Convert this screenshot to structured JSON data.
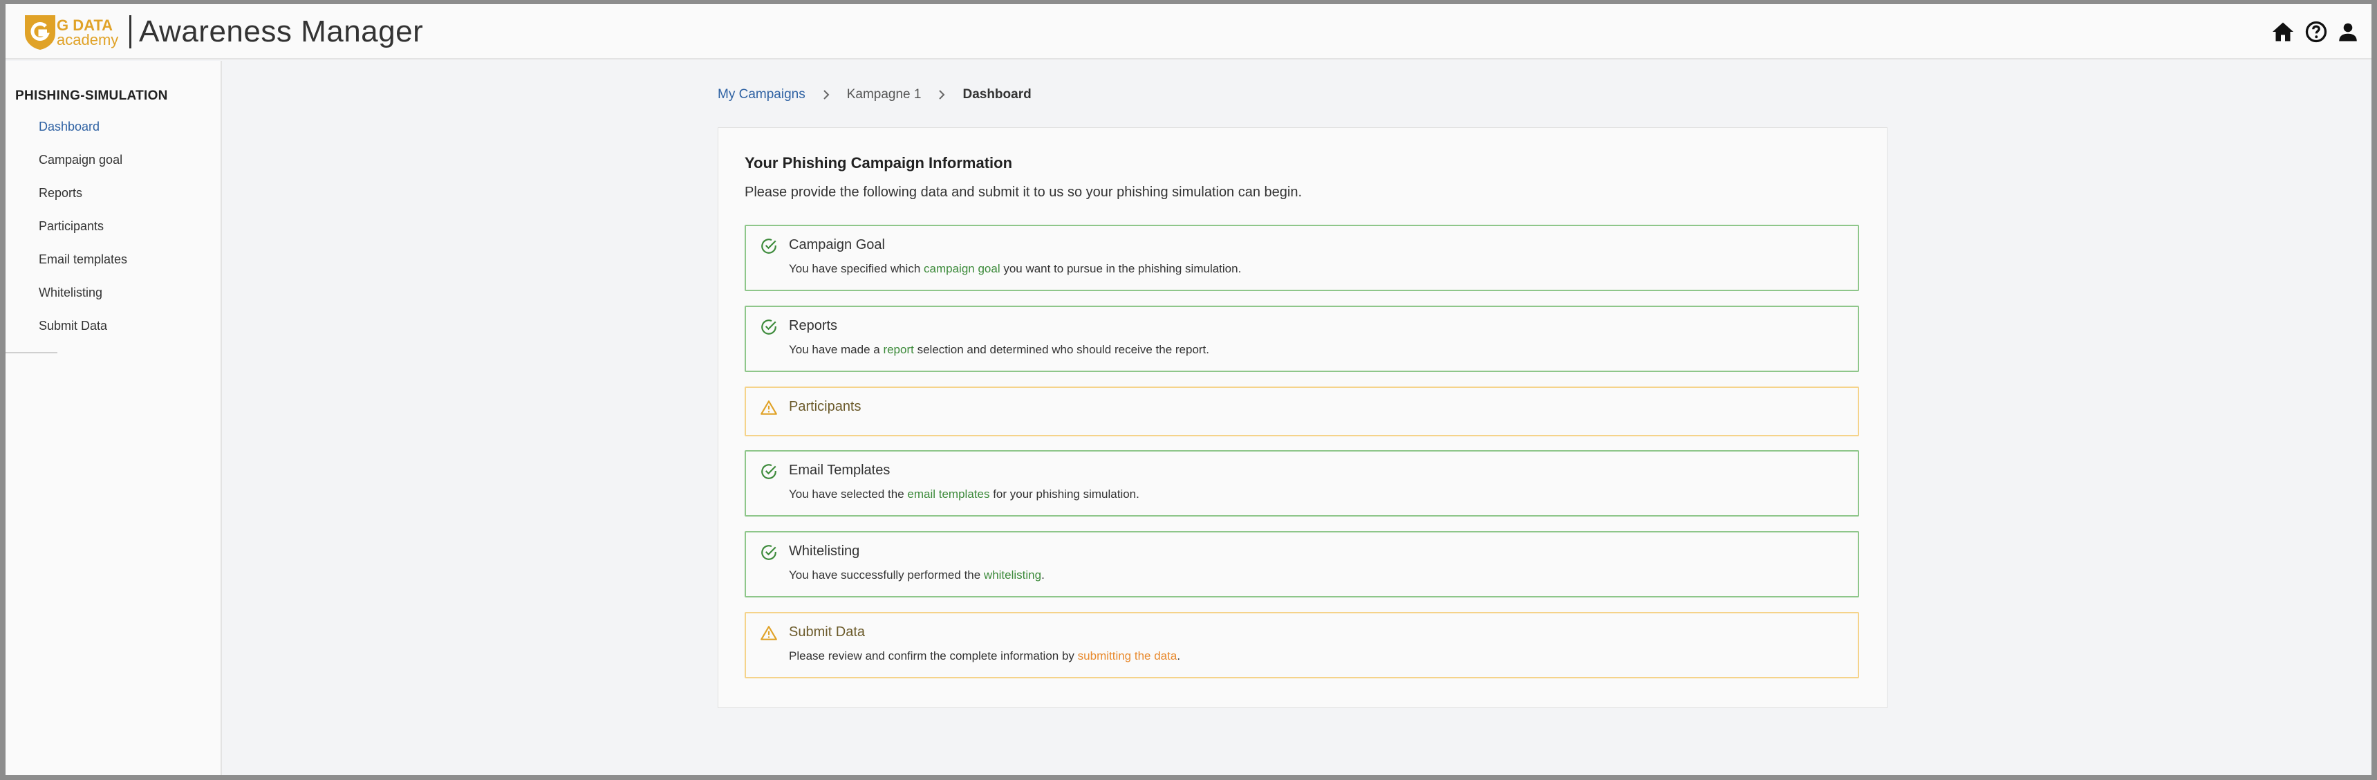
{
  "app": {
    "logo_line1": "G DATA",
    "logo_line2": "academy",
    "title": "Awareness Manager"
  },
  "topbar_icons": [
    "home-icon",
    "help-icon",
    "account-icon"
  ],
  "sidebar": {
    "section_title": "PHISHING-SIMULATION",
    "items": [
      {
        "label": "Dashboard",
        "active": true
      },
      {
        "label": "Campaign goal"
      },
      {
        "label": "Reports"
      },
      {
        "label": "Participants"
      },
      {
        "label": "Email templates"
      },
      {
        "label": "Whitelisting"
      },
      {
        "label": "Submit Data"
      }
    ]
  },
  "breadcrumb": {
    "home": "My Campaigns",
    "campaign": "Kampagne 1",
    "current": "Dashboard"
  },
  "card": {
    "title": "Your Phishing Campaign Information",
    "subtitle": "Please provide the following data and submit it to us so your phishing simulation can begin."
  },
  "items": [
    {
      "status": "done",
      "icon": "check-circle-icon",
      "title": "Campaign Goal",
      "pre": "You have specified which ",
      "link": "campaign goal",
      "post": " you want to pursue in the phishing simulation."
    },
    {
      "status": "done",
      "icon": "check-circle-icon",
      "title": "Reports",
      "pre": "You have made a ",
      "link": "report",
      "post": " selection and determined who should receive the report."
    },
    {
      "status": "warning",
      "icon": "warning-icon",
      "title": "Participants"
    },
    {
      "status": "done",
      "icon": "check-circle-icon",
      "title": "Email Templates",
      "pre": "You have selected the ",
      "link": "email templates",
      "post": " for your phishing simulation."
    },
    {
      "status": "done",
      "icon": "check-circle-icon",
      "title": "Whitelisting",
      "pre": "You have successfully performed the ",
      "link": "whitelisting",
      "post": "."
    },
    {
      "status": "warning",
      "icon": "warning-icon",
      "title": "Submit Data",
      "pre": "Please review and confirm the complete information by ",
      "link": "submitting the data",
      "post": "."
    }
  ],
  "colors": {
    "brand": "#e0a227",
    "link": "#2f62a3",
    "success": "#3c8a3a",
    "success_border": "#8ec68a",
    "warning": "#e88a2e",
    "warning_border": "#f5d38a"
  }
}
